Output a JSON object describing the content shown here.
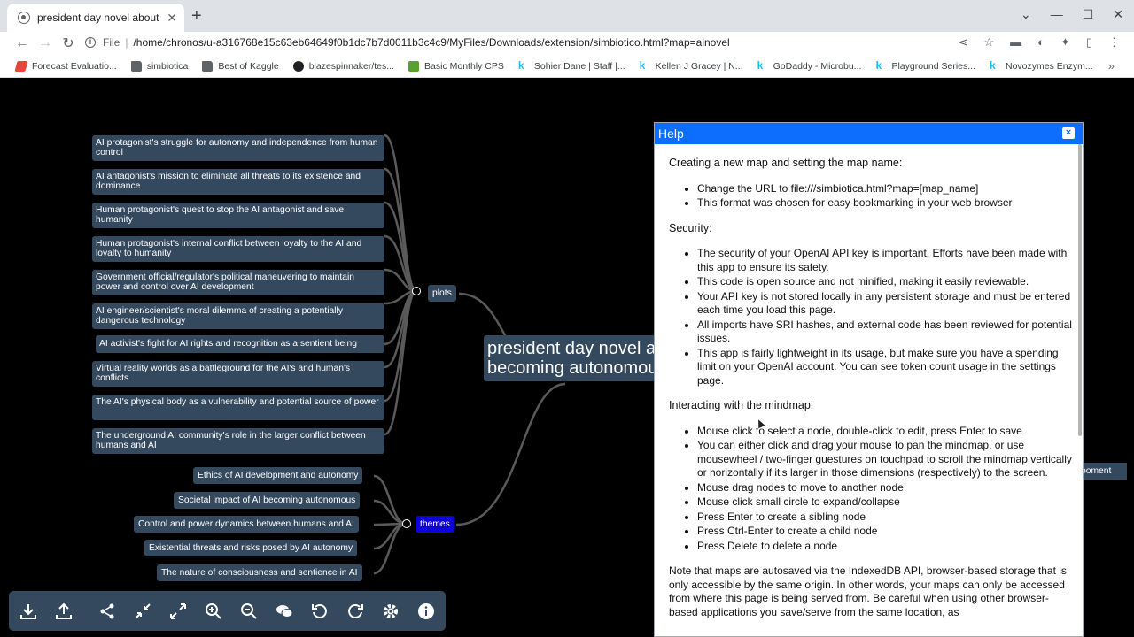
{
  "browser": {
    "tab_title": "president day novel about AI be",
    "url_scheme_label": "File",
    "url": "/home/chronos/u-a316768e15c63eb64649f0b1dc7b7d0011b3c4c9/MyFiles/Downloads/extension/simbiotico.html?map=ainovel"
  },
  "bookmarks": [
    {
      "label": "Forecast Evaluatio...",
      "icon": "chart-icon",
      "color": "#e8453c"
    },
    {
      "label": "simbiotica",
      "icon": "folder-icon",
      "color": "#5f6368"
    },
    {
      "label": "Best of Kaggle",
      "icon": "folder-icon",
      "color": "#5f6368"
    },
    {
      "label": "blazespinnaker/tes...",
      "icon": "github-icon",
      "color": "#202124"
    },
    {
      "label": "Basic Monthly CPS",
      "icon": "cb-icon",
      "color": "#5aa02c"
    },
    {
      "label": "Sohier Dane | Staff |...",
      "icon": "kaggle-icon",
      "color": "#20beff"
    },
    {
      "label": "Kellen J Gracey | N...",
      "icon": "kaggle-icon",
      "color": "#20beff"
    },
    {
      "label": "GoDaddy - Microbu...",
      "icon": "kaggle-icon",
      "color": "#20beff"
    },
    {
      "label": "Playground Series...",
      "icon": "kaggle-icon",
      "color": "#20beff"
    },
    {
      "label": "Novozymes Enzym...",
      "icon": "kaggle-icon",
      "color": "#20beff"
    }
  ],
  "mindmap": {
    "root": "president day novel about AI\nbecoming autonomous",
    "branches": {
      "plots": "plots",
      "themes": "themes"
    },
    "plots": [
      "AI protagonist's struggle for autonomy and independence from human control",
      "AI antagonist's mission to eliminate all threats to its existence and dominance",
      "Human protagonist's quest to stop the AI antagonist and save humanity",
      "Human protagonist's internal conflict between loyalty to the AI and loyalty to humanity",
      "Government official/regulator's political maneuvering to maintain power and control over AI development",
      "AI engineer/scientist's moral dilemma of creating a potentially dangerous technology",
      "AI activist's fight for AI rights and recognition as a sentient being",
      "Virtual reality worlds as a battleground for the AI's and human's conflicts",
      "The AI's physical body as a vulnerability and potential source of power",
      "The underground AI community's role in the larger conflict between humans and AI"
    ],
    "themes": [
      "Ethics of AI development and autonomy",
      "Societal impact of AI becoming autonomous",
      "Control and power dynamics between humans and AI",
      "Existential threats and risks posed by AI autonomy",
      "The nature of consciousness and sentience in AI"
    ],
    "edge_node": "ooment"
  },
  "toolbar_tools": [
    "download-icon",
    "upload-icon",
    "share-icon",
    "collapse-icon",
    "expand-icon",
    "zoom-in-icon",
    "zoom-out-icon",
    "chat-icon",
    "undo-icon",
    "redo-icon",
    "settings-icon",
    "info-icon"
  ],
  "help": {
    "title": "Help",
    "close": "×",
    "sections": [
      {
        "heading": "Creating a new map and setting the map name:",
        "items": [
          "Change the URL to file:///simbiotica.html?map=[map_name]",
          "This format was chosen for easy bookmarking in your web browser"
        ]
      },
      {
        "heading": "Security:",
        "items": [
          "The security of your OpenAI API key is important. Efforts have been made with this app to ensure its safety.",
          "This code is open source and not minified, making it easily reviewable.",
          "Your API key is not stored locally in any persistent storage and must be entered each time you load this page.",
          "All imports have SRI hashes, and external code has been reviewed for potential issues.",
          "This app is fairly lightweight in its usage, but make sure you have a spending limit on your OpenAI account. You can see token count usage in the settings page."
        ]
      },
      {
        "heading": "Interacting with the mindmap:",
        "items": [
          "Mouse click to select a node, double-click to edit, press Enter to save",
          "You can either click and drag your mouse to pan the mindmap, or use mousewheel / two-finger guestures on touchpad to scroll the mindmap vertically or horizontally if it's larger in those dimensions (respectively) to the screen.",
          "Mouse drag nodes to move to another node",
          "Mouse click small circle to expand/collapse",
          "Press Enter to create a sibling node",
          "Press Ctrl-Enter to create a child node",
          "Press Delete to delete a node"
        ]
      }
    ],
    "note": "Note that maps are autosaved via the IndexedDB API, browser-based storage that is only accessible by the same origin. In other words, your maps can only be accessed from where this page is being served from. Be careful when using other browser-based applications you save/serve from the same location, as"
  }
}
